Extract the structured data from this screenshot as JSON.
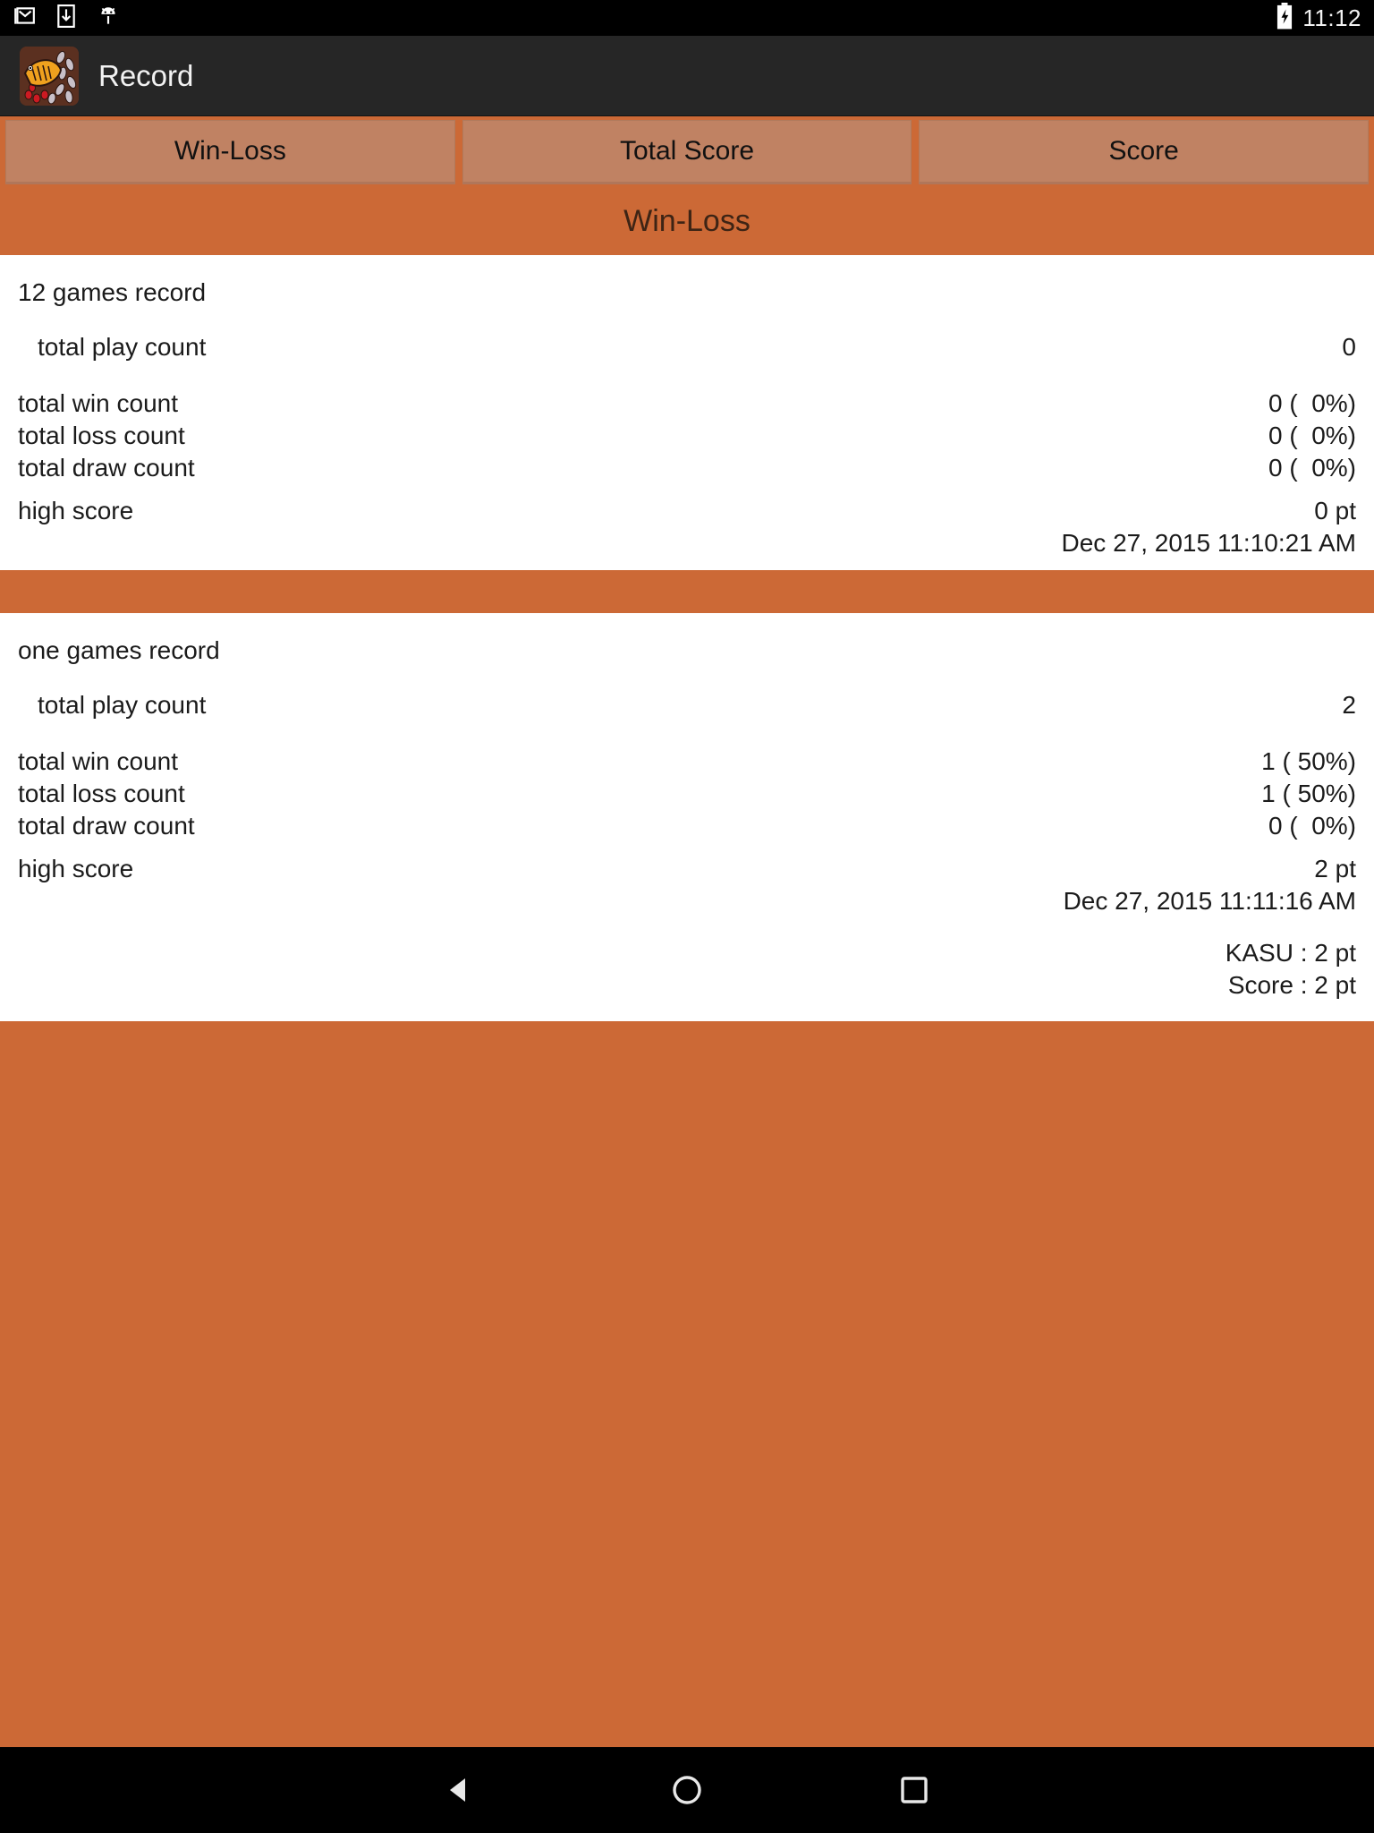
{
  "statusbar": {
    "time": "11:12",
    "icons": [
      "gmail-icon",
      "download-icon",
      "android-debug-icon"
    ],
    "battery_icon": "battery-charging-icon"
  },
  "actionbar": {
    "app_icon": "app-launcher-icon",
    "title": "Record"
  },
  "tabs": [
    {
      "label": "Win-Loss",
      "selected": true
    },
    {
      "label": "Total Score",
      "selected": false
    },
    {
      "label": "Score",
      "selected": false
    }
  ],
  "section": {
    "title": "Win-Loss"
  },
  "records": [
    {
      "heading": "12 games record",
      "play_count_label": "total play count",
      "play_count_value": "0",
      "win_label": "total win count",
      "win_value": "0 (  0%)",
      "loss_label": "total loss count",
      "loss_value": "0 (  0%)",
      "draw_label": "total draw count",
      "draw_value": "0 (  0%)",
      "high_score_label": "high score",
      "high_score_value": "0 pt",
      "high_score_date": "Dec 27, 2015 11:10:21 AM",
      "extra_lines": []
    },
    {
      "heading": "one games record",
      "play_count_label": "total play count",
      "play_count_value": "2",
      "win_label": "total win count",
      "win_value": "1 ( 50%)",
      "loss_label": "total loss count",
      "loss_value": "1 ( 50%)",
      "draw_label": "total draw count",
      "draw_value": "0 (  0%)",
      "high_score_label": "high score",
      "high_score_value": "2 pt",
      "high_score_date": "Dec 27, 2015 11:11:16 AM",
      "extra_lines": [
        "KASU : 2 pt",
        "Score : 2 pt"
      ]
    }
  ],
  "navbar": {
    "back": "back-triangle-icon",
    "home": "home-circle-icon",
    "recents": "recents-square-icon"
  },
  "colors": {
    "accent_orange": "#cc6936",
    "tab_face": "#c08263",
    "actionbar": "#262626",
    "text_dark": "#1b1b1b",
    "section_title_text": "#3d2415"
  }
}
